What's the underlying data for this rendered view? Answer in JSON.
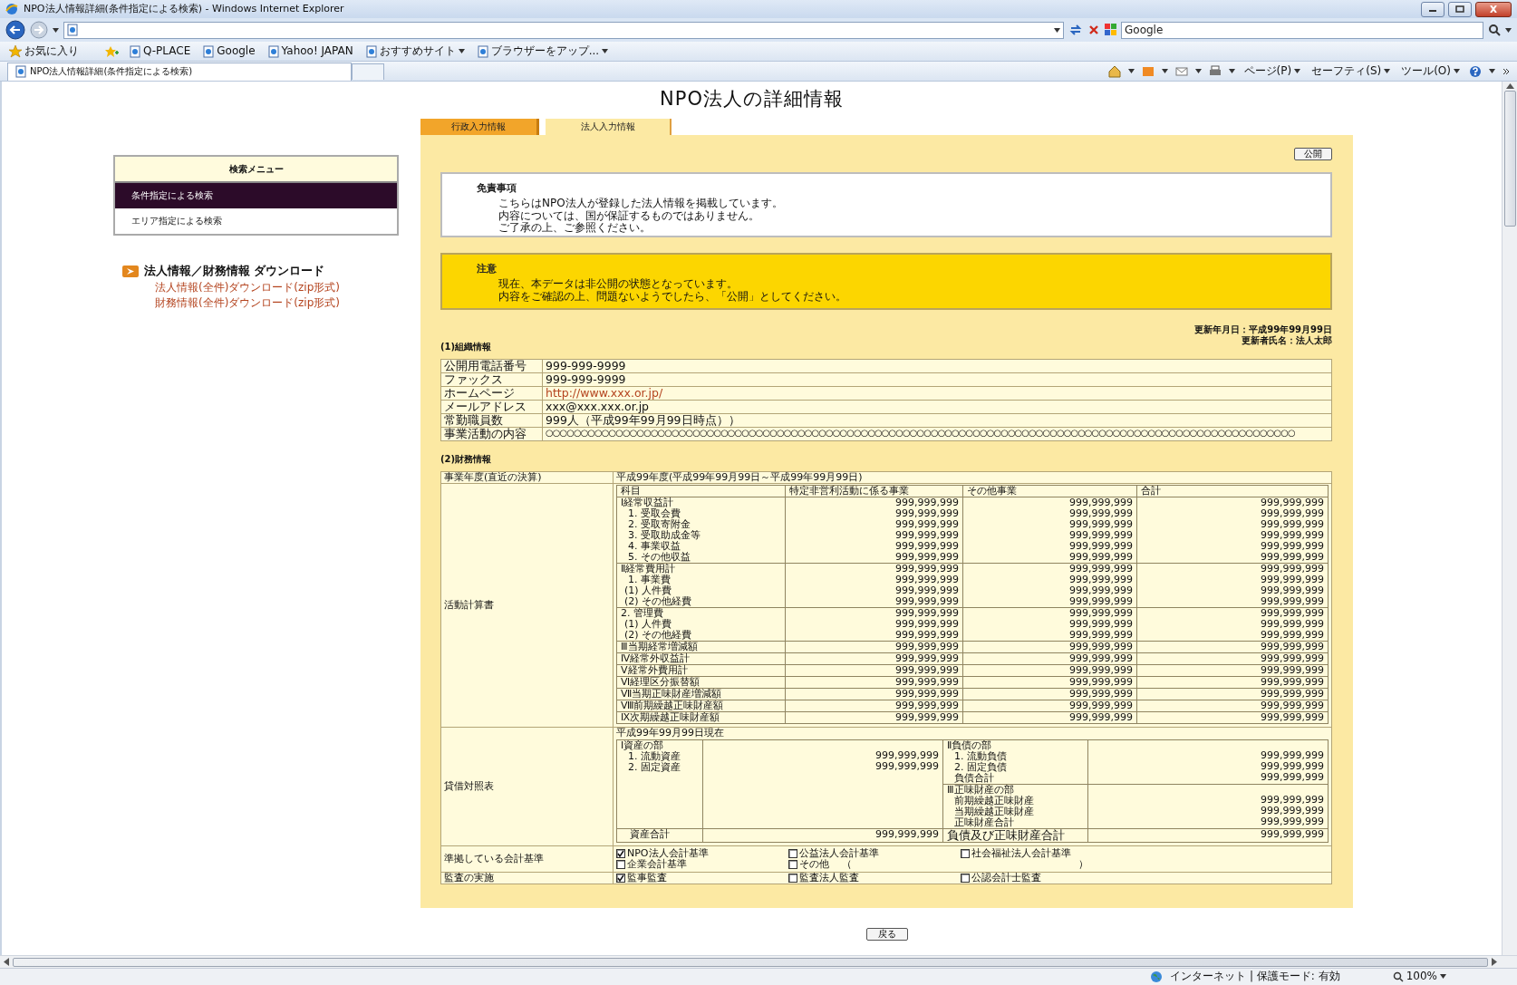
{
  "browser": {
    "title": "NPO法人情報詳細(条件指定による検索) - Windows Internet Explorer",
    "search_placeholder": "Google",
    "favorites_label": "お気に入り",
    "links": [
      {
        "label": "Q-PLACE",
        "dropdown": false
      },
      {
        "label": "Google",
        "dropdown": false
      },
      {
        "label": "Yahoo! JAPAN",
        "dropdown": false
      },
      {
        "label": "おすすめサイト",
        "dropdown": true
      },
      {
        "label": "ブラウザーをアップ...",
        "dropdown": true
      }
    ],
    "tab_title": "NPO法人情報詳細(条件指定による検索)",
    "commands": [
      "ページ(P)",
      "セーフティ(S)",
      "ツール(O)"
    ],
    "status": "インターネット | 保護モード: 有効",
    "zoom": "100%"
  },
  "page": {
    "heading": "NPO法人の詳細情報"
  },
  "tabs": [
    {
      "label": "行政入力情報",
      "selected": false
    },
    {
      "label": "法人入力情報",
      "selected": true
    }
  ],
  "sidebar": {
    "menu_title": "検索メニュー",
    "items": [
      {
        "label": "条件指定による検索",
        "selected": true
      },
      {
        "label": "エリア指定による検索",
        "selected": false
      }
    ],
    "download_heading": "法人情報／財務情報 ダウンロード",
    "download_links": [
      "法人情報(全件)ダウンロード(zip形式)",
      "財務情報(全件)ダウンロード(zip形式)"
    ]
  },
  "publish_button": "公開",
  "disclaimer": {
    "title": "免責事項",
    "lines": [
      "こちらはNPO法人が登録した法人情報を掲載しています。",
      "内容については、国が保証するものではありません。",
      "ご了承の上、ご参照ください。"
    ]
  },
  "notice": {
    "title": "注意",
    "lines": [
      "現在、本データは非公開の状態となっています。",
      "内容をご確認の上、問題ないようでしたら、「公開」としてください。"
    ]
  },
  "update_info": [
    "更新年月日：平成99年99月99日",
    "更新者氏名：法人太郎"
  ],
  "organization": {
    "heading": "(1)組織情報",
    "rows": [
      {
        "label": "公開用電話番号",
        "value": "999-999-9999",
        "kind": "text"
      },
      {
        "label": "ファックス",
        "value": "999-999-9999",
        "kind": "text"
      },
      {
        "label": "ホームページ",
        "value": "http://www.xxx.or.jp/",
        "kind": "link"
      },
      {
        "label": "メールアドレス",
        "value": "xxx@xxx.xxx.or.jp",
        "kind": "text"
      },
      {
        "label": "常勤職員数",
        "value": "999人（平成99年99月99日時点））",
        "kind": "text"
      },
      {
        "label": "事業活動の内容",
        "value": "○○○○○○○○○○○○○○○○○○○○○○○○○○○○○○○○○○○○○○○○○○○○○○○○○○○○○○○○○○○○○○○○○○○○○○○○○○○○○○○○○○○○○○○○○○○○○○○○○○○○○○○○○○○",
        "kind": "text"
      }
    ]
  },
  "finance": {
    "heading": "(2)財務情報",
    "fiscal_year_label": "事業年度(直近の決算)",
    "fiscal_year": "平成99年度(平成99年99月99日～平成99年99月99日)",
    "activity": {
      "label": "活動計算書",
      "columns": [
        "科目",
        "特定非営利活動に係る事業",
        "その他事業",
        "合計"
      ],
      "groups": [
        {
          "lines": [
            {
              "label": "Ⅰ経常収益計",
              "values": [
                "999,999,999",
                "999,999,999",
                "999,999,999"
              ]
            },
            {
              "label": "1. 受取会費",
              "values": [
                "999,999,999",
                "999,999,999",
                "999,999,999"
              ]
            },
            {
              "label": "2. 受取寄附金",
              "values": [
                "999,999,999",
                "999,999,999",
                "999,999,999"
              ]
            },
            {
              "label": "3. 受取助成金等",
              "values": [
                "999,999,999",
                "999,999,999",
                "999,999,999"
              ]
            },
            {
              "label": "4. 事業収益",
              "values": [
                "999,999,999",
                "999,999,999",
                "999,999,999"
              ]
            },
            {
              "label": "5. その他収益",
              "values": [
                "999,999,999",
                "999,999,999",
                "999,999,999"
              ]
            }
          ]
        },
        {
          "lines": [
            {
              "label": "Ⅱ経常費用計",
              "values": [
                "999,999,999",
                "999,999,999",
                "999,999,999"
              ]
            },
            {
              "label": "1. 事業費",
              "values": [
                "999,999,999",
                "999,999,999",
                "999,999,999"
              ]
            },
            {
              "label": "(1) 人件費",
              "values": [
                "999,999,999",
                "999,999,999",
                "999,999,999"
              ]
            },
            {
              "label": "(2) その他経費",
              "values": [
                "999,999,999",
                "999,999,999",
                "999,999,999"
              ]
            }
          ]
        },
        {
          "lines": [
            {
              "label": "2. 管理費",
              "values": [
                "999,999,999",
                "999,999,999",
                "999,999,999"
              ]
            },
            {
              "label": "(1) 人件費",
              "values": [
                "999,999,999",
                "999,999,999",
                "999,999,999"
              ]
            },
            {
              "label": "(2) その他経費",
              "values": [
                "999,999,999",
                "999,999,999",
                "999,999,999"
              ]
            }
          ]
        },
        {
          "lines": [
            {
              "label": "Ⅲ当期経常増減額",
              "values": [
                "999,999,999",
                "999,999,999",
                "999,999,999"
              ]
            }
          ]
        },
        {
          "lines": [
            {
              "label": "Ⅳ経常外収益計",
              "values": [
                "999,999,999",
                "999,999,999",
                "999,999,999"
              ]
            }
          ]
        },
        {
          "lines": [
            {
              "label": "Ⅴ経常外費用計",
              "values": [
                "999,999,999",
                "999,999,999",
                "999,999,999"
              ]
            }
          ]
        },
        {
          "lines": [
            {
              "label": "Ⅵ経理区分振替額",
              "values": [
                "999,999,999",
                "999,999,999",
                "999,999,999"
              ]
            }
          ]
        },
        {
          "lines": [
            {
              "label": "Ⅶ当期正味財産増減額",
              "values": [
                "999,999,999",
                "999,999,999",
                "999,999,999"
              ]
            }
          ]
        },
        {
          "lines": [
            {
              "label": "Ⅷ前期繰越正味財産額",
              "values": [
                "999,999,999",
                "999,999,999",
                "999,999,999"
              ]
            }
          ]
        },
        {
          "lines": [
            {
              "label": "Ⅸ次期繰越正味財産額",
              "values": [
                "999,999,999",
                "999,999,999",
                "999,999,999"
              ]
            }
          ]
        }
      ]
    },
    "balance": {
      "label": "貸借対照表",
      "date": "平成99年99月99日現在",
      "assets": [
        {
          "label": "Ⅰ資産の部"
        },
        {
          "label": "1. 流動資産",
          "value": "999,999,999"
        },
        {
          "label": "2. 固定資産",
          "value": "999,999,999"
        }
      ],
      "assets_total": {
        "label": "資産合計",
        "value": "999,999,999"
      },
      "liabilities": [
        {
          "label": "Ⅱ負債の部"
        },
        {
          "label": "1. 流動負債",
          "value": "999,999,999"
        },
        {
          "label": "2. 固定負債",
          "value": "999,999,999"
        },
        {
          "label": "負債合計",
          "value": "999,999,999"
        }
      ],
      "net_assets": [
        {
          "label": "Ⅲ正味財産の部"
        },
        {
          "label": "前期繰越正味財産",
          "value": "999,999,999"
        },
        {
          "label": "当期繰越正味財産",
          "value": "999,999,999"
        },
        {
          "label": "正味財産合計",
          "value": "999,999,999"
        }
      ],
      "total": {
        "label": "負債及び正味財産合計",
        "value": "999,999,999"
      }
    },
    "standards": {
      "label": "準拠している会計基準",
      "options": [
        {
          "label": "NPO法人会計基準",
          "checked": true
        },
        {
          "label": "公益法人会計基準",
          "checked": false
        },
        {
          "label": "社会福祉法人会計基準",
          "checked": false
        },
        {
          "label": "企業会計基準",
          "checked": false
        },
        {
          "label": "その他",
          "checked": false,
          "note_open": "（",
          "note_close": "）"
        }
      ]
    },
    "audit": {
      "label": "監査の実施",
      "options": [
        {
          "label": "監事監査",
          "checked": true
        },
        {
          "label": "監査法人監査",
          "checked": false
        },
        {
          "label": "公認会計士監査",
          "checked": false
        }
      ]
    }
  },
  "back_button": "戻る"
}
